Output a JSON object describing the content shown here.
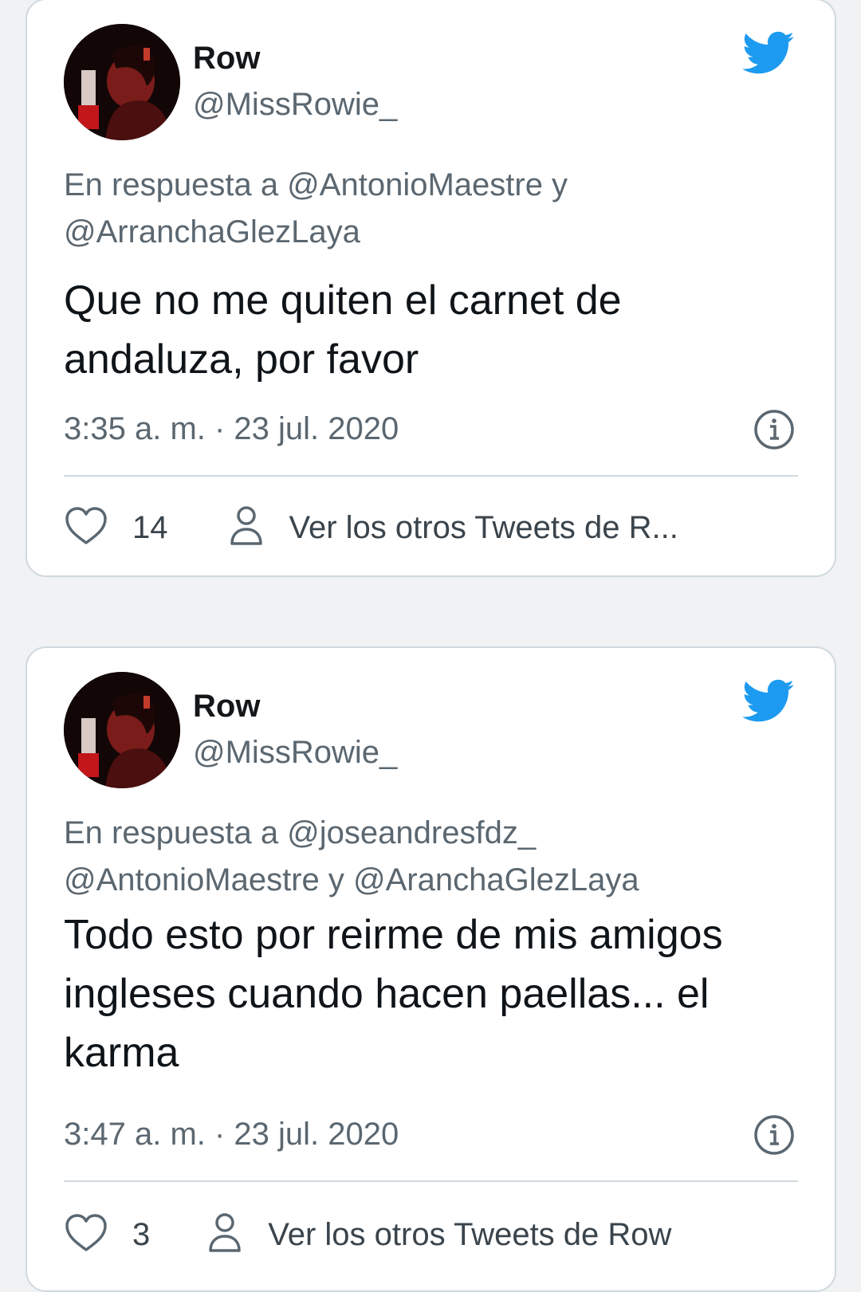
{
  "colors": {
    "twitter_blue": "#1d9bf0",
    "secondary_text": "#5b6770",
    "primary_text": "#0f1419",
    "border": "#cfd9de",
    "page_background": "#f0f2f4"
  },
  "icons": [
    "twitter-bird-icon",
    "info-icon",
    "heart-icon",
    "person-icon"
  ],
  "tweets": [
    {
      "display_name": "Row",
      "handle": "@MissRowie_",
      "reply_to_lines": [
        "En respuesta a @AntonioMaestre y",
        "@ArranchaGlezLaya"
      ],
      "text_lines": [
        "Que no me quiten el carnet de",
        "andaluza, por favor"
      ],
      "timestamp": "3:35 a. m. · 23 jul. 2020",
      "likes": "14",
      "profile_link": "Ver los otros Tweets de R..."
    },
    {
      "display_name": "Row",
      "handle": "@MissRowie_",
      "reply_to_lines": [
        "En respuesta a @joseandresfdz_",
        "@AntonioMaestre y @AranchaGlezLaya"
      ],
      "text_lines": [
        "Todo esto por reirme de mis amigos",
        "ingleses cuando hacen paellas... el",
        "karma"
      ],
      "timestamp": "3:47 a. m. · 23 jul. 2020",
      "likes": "3",
      "profile_link": "Ver los otros Tweets de Row"
    }
  ]
}
